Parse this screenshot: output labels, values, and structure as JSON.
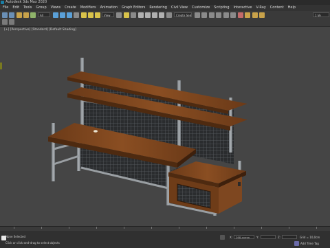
{
  "app": {
    "title": "Autodesk 3ds Max 2020"
  },
  "menu": [
    "File",
    "Edit",
    "Tools",
    "Group",
    "Views",
    "Create",
    "Modifiers",
    "Animation",
    "Graph Editors",
    "Rendering",
    "Civil View",
    "Customize",
    "Scripting",
    "Interactive",
    "V-Ray",
    "Content",
    "Help"
  ],
  "toolbar": {
    "selection_filter": "All",
    "view_dropdown": "View",
    "selection_set": "Create Selection Se",
    "workspace": "1 Ve"
  },
  "viewport": {
    "label": "[+] [Perspective] [Standard] [Default Shading]"
  },
  "status": {
    "selection": "None Selected",
    "prompt": "Click or click-and-drag to select objects",
    "x_label": "X:",
    "x_value": "268,xxmm",
    "y_label": "Y:",
    "z_label": "Z:",
    "grid": "Grid = 10,0cm",
    "add_time_tag": "Add Time Tag"
  },
  "colors": {
    "wood": "#7a4520",
    "wood_light": "#9a5a2a",
    "metal": "#8a8f93",
    "mesh": "#2a2c2e",
    "viewport_bg": "#454545"
  }
}
